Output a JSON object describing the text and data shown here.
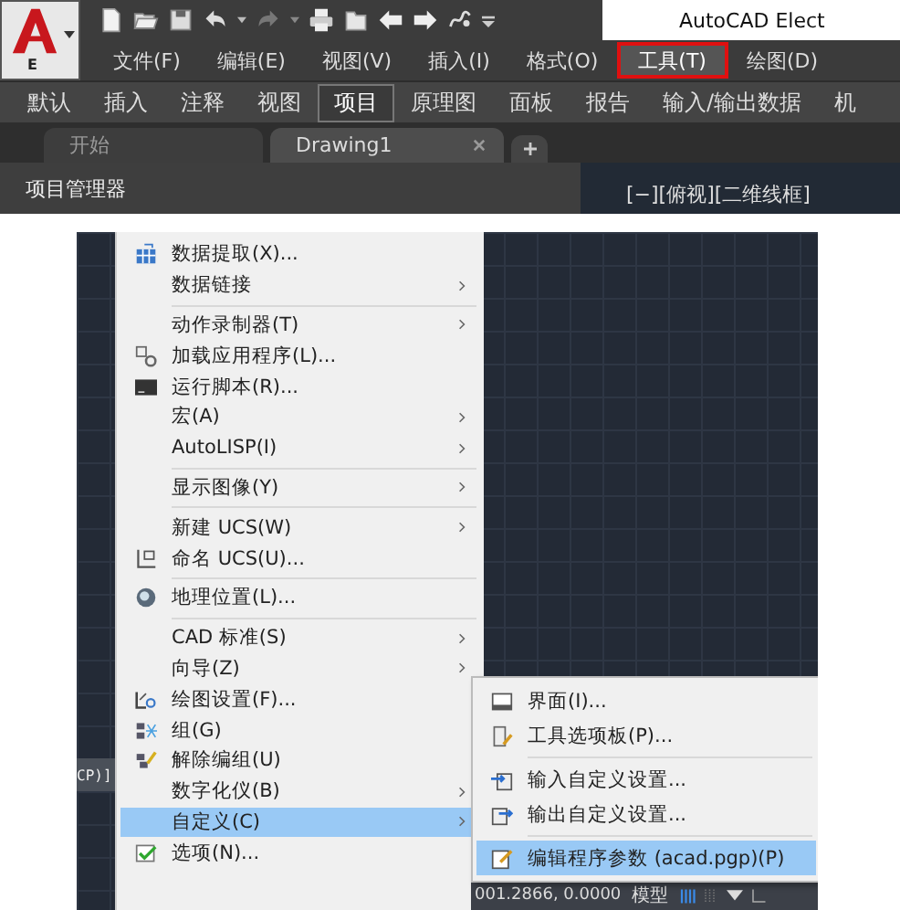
{
  "app_button": {
    "letter": "E"
  },
  "title": "AutoCAD Elect",
  "menu_bar": [
    {
      "label": "文件(F)",
      "selected": false
    },
    {
      "label": "编辑(E)",
      "selected": false
    },
    {
      "label": "视图(V)",
      "selected": false
    },
    {
      "label": "插入(I)",
      "selected": false
    },
    {
      "label": "格式(O)",
      "selected": false
    },
    {
      "label": "工具(T)",
      "selected": true
    },
    {
      "label": "绘图(D)",
      "selected": false
    }
  ],
  "ribbon_tabs": [
    {
      "label": "默认",
      "selected": false
    },
    {
      "label": "插入",
      "selected": false
    },
    {
      "label": "注释",
      "selected": false
    },
    {
      "label": "视图",
      "selected": false
    },
    {
      "label": "项目",
      "selected": true
    },
    {
      "label": "原理图",
      "selected": false
    },
    {
      "label": "面板",
      "selected": false
    },
    {
      "label": "报告",
      "selected": false
    },
    {
      "label": "输入/输出数据",
      "selected": false
    },
    {
      "label": "机",
      "selected": false
    }
  ],
  "file_tabs": [
    {
      "label": "开始",
      "selected": false
    },
    {
      "label": "Drawing1",
      "selected": true
    }
  ],
  "palette": {
    "title": "项目管理器"
  },
  "viewport": {
    "label": "[−][俯视][二维线框]"
  },
  "command_line": {
    "text": "CP)]"
  },
  "tools_menu": {
    "groups": [
      [
        {
          "label": "数据提取(X)...",
          "has_icon": true,
          "has_submenu": false,
          "selected": false
        },
        {
          "label": "数据链接",
          "has_icon": false,
          "has_submenu": true,
          "selected": false
        }
      ],
      [
        {
          "label": "动作录制器(T)",
          "has_icon": false,
          "has_submenu": true,
          "selected": false
        },
        {
          "label": "加载应用程序(L)...",
          "has_icon": true,
          "has_submenu": false,
          "selected": false
        },
        {
          "label": "运行脚本(R)...",
          "has_icon": true,
          "has_submenu": false,
          "selected": false
        },
        {
          "label": "宏(A)",
          "has_icon": false,
          "has_submenu": true,
          "selected": false
        },
        {
          "label": "AutoLISP(I)",
          "has_icon": false,
          "has_submenu": true,
          "selected": false
        }
      ],
      [
        {
          "label": "显示图像(Y)",
          "has_icon": false,
          "has_submenu": true,
          "selected": false
        }
      ],
      [
        {
          "label": "新建 UCS(W)",
          "has_icon": false,
          "has_submenu": true,
          "selected": false
        },
        {
          "label": "命名 UCS(U)...",
          "has_icon": true,
          "has_submenu": false,
          "selected": false
        }
      ],
      [
        {
          "label": "地理位置(L)...",
          "has_icon": true,
          "has_submenu": false,
          "selected": false
        }
      ],
      [
        {
          "label": "CAD 标准(S)",
          "has_icon": false,
          "has_submenu": true,
          "selected": false
        },
        {
          "label": "向导(Z)",
          "has_icon": false,
          "has_submenu": true,
          "selected": false
        },
        {
          "label": "绘图设置(F)...",
          "has_icon": true,
          "has_submenu": false,
          "selected": false
        },
        {
          "label": "组(G)",
          "has_icon": true,
          "has_submenu": false,
          "selected": false
        },
        {
          "label": "解除编组(U)",
          "has_icon": true,
          "has_submenu": false,
          "selected": false
        },
        {
          "label": "数字化仪(B)",
          "has_icon": false,
          "has_submenu": true,
          "selected": false
        },
        {
          "label": "自定义(C)",
          "has_icon": false,
          "has_submenu": true,
          "selected": true
        },
        {
          "label": "选项(N)...",
          "has_icon": true,
          "has_submenu": false,
          "selected": false
        }
      ]
    ]
  },
  "customize_submenu": {
    "groups": [
      [
        {
          "label": "界面(I)...",
          "selected": false
        },
        {
          "label": "工具选项板(P)...",
          "selected": false
        }
      ],
      [
        {
          "label": "输入自定义设置...",
          "selected": false
        },
        {
          "label": "输出自定义设置...",
          "selected": false
        }
      ],
      [
        {
          "label": "编辑程序参数 (acad.pgp)(P)",
          "selected": true
        }
      ]
    ]
  },
  "status_bar": {
    "coordinates": "001.2866, 0.0000",
    "space": "模型"
  }
}
